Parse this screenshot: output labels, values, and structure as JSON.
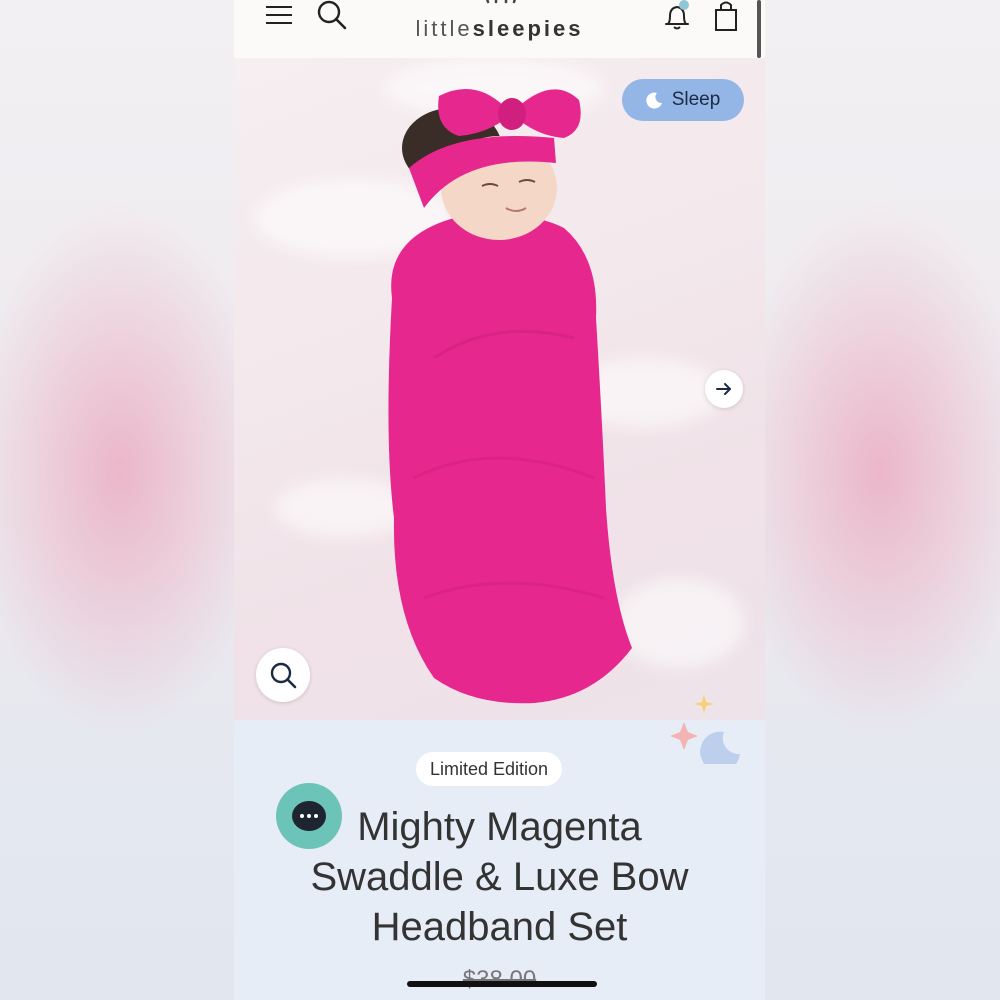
{
  "header": {
    "logo_light": "little",
    "logo_bold": "sleepies",
    "notification_dot_color": "#8fc7d6"
  },
  "hero": {
    "category_pill": "Sleep",
    "pill_color": "#93b6e6",
    "swaddle_color": "#e6278e"
  },
  "product": {
    "badge": "Limited Edition",
    "title_line1": "Mighty Magenta",
    "title_line2": "Swaddle & Luxe Bow",
    "title_line3": "Headband Set",
    "price": "$38.00"
  },
  "icons": {
    "menu": "hamburger-icon",
    "search": "search-icon",
    "notifications": "bell-icon",
    "cart": "shopping-bag-icon",
    "next": "arrow-right-icon",
    "zoom": "magnifier-icon",
    "chat": "chat-bubble-icon"
  }
}
